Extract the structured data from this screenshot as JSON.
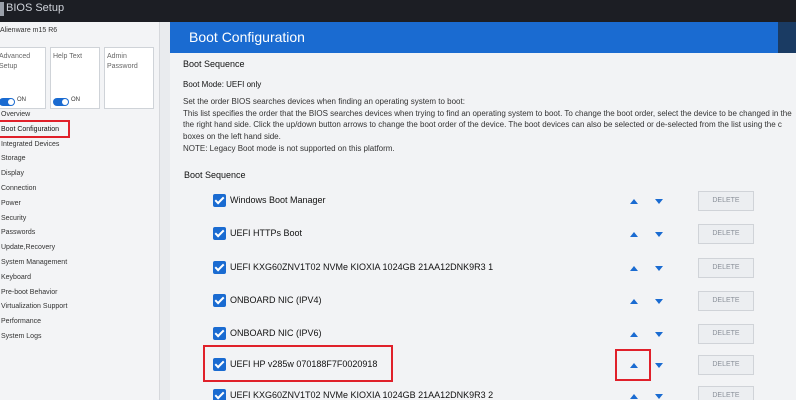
{
  "app": {
    "title": "BIOS Setup",
    "device": "Alienware m15 R6"
  },
  "sidebar": {
    "modes": [
      {
        "label": "Advanced Setup",
        "toggle": "ON"
      },
      {
        "label": "Help Text",
        "toggle": "ON"
      },
      {
        "label": "Admin Password",
        "toggle": ""
      }
    ],
    "items": [
      "Overview",
      "Boot Configuration",
      "Integrated Devices",
      "Storage",
      "Display",
      "Connection",
      "Power",
      "Security",
      "Passwords",
      "Update,Recovery",
      "System Management",
      "Keyboard",
      "Pre-boot Behavior",
      "Virtualization Support",
      "Performance",
      "System Logs"
    ],
    "active_index": 1
  },
  "main": {
    "title": "Boot Configuration",
    "section1_title": "Boot Sequence",
    "boot_mode": "Boot Mode: UEFI only",
    "description": [
      "Set the order BIOS searches devices when finding an operating system to boot:",
      "This list specifies the order that the BIOS searches devices when trying to find an operating system to boot. To change the boot order, select the device to be changed in the",
      "the right hand side.  Click the up/down button arrows to change the boot order of the device. The boot devices can also be selected or de-selected from the list using the c",
      "boxes on the left hand side.",
      "NOTE: Legacy Boot mode is not supported on this platform."
    ],
    "section2_title": "Boot Sequence",
    "delete_label": "DELETE",
    "boot_items": [
      {
        "label": "Windows Boot Manager",
        "checked": true
      },
      {
        "label": "UEFI HTTPs Boot",
        "checked": true
      },
      {
        "label": "UEFI KXG60ZNV1T02 NVMe KIOXIA 1024GB 21AA12DNK9R3 1",
        "checked": true
      },
      {
        "label": "ONBOARD NIC (IPV4)",
        "checked": true
      },
      {
        "label": "ONBOARD NIC (IPV6)",
        "checked": true
      },
      {
        "label": "UEFI HP v285w 070188F7F0020918",
        "checked": true
      },
      {
        "label": "UEFI KXG60ZNV1T02 NVMe KIOXIA 1024GB 21AA12DNK9R3 2",
        "checked": true
      }
    ]
  },
  "colors": {
    "accent": "#1a6bd1",
    "highlight": "#e0202a"
  }
}
